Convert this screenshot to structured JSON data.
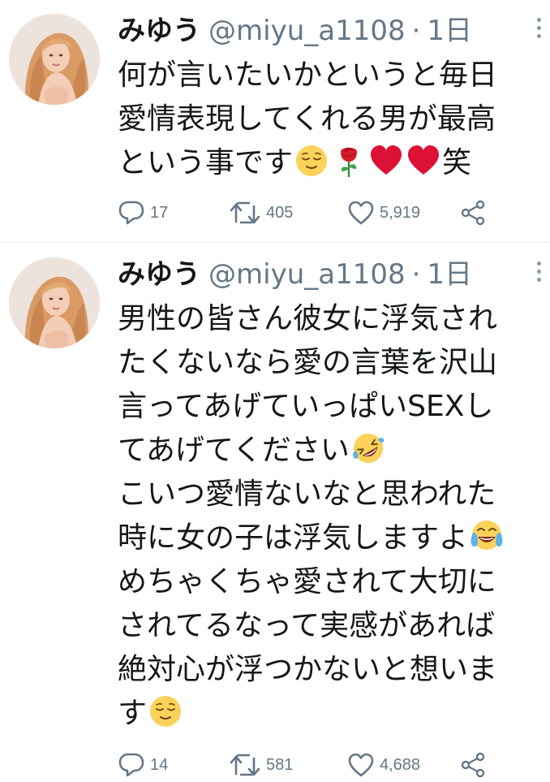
{
  "tweets": [
    {
      "author": {
        "name": "みゆう",
        "handle": "@miyu_a1108",
        "avatar_icon": "profile-photo"
      },
      "separator": "·",
      "time": "1日",
      "text_lines": [
        "何が言いたいかというと毎日",
        "愛情表現してくれる男が最高",
        "という事です",
        "笑"
      ],
      "emojis": [
        "relieved-face",
        "rose",
        "heart",
        "heart"
      ],
      "stats": {
        "replies": "17",
        "retweets": "405",
        "likes": "5,919"
      }
    },
    {
      "author": {
        "name": "みゆう",
        "handle": "@miyu_a1108",
        "avatar_icon": "profile-photo"
      },
      "separator": "·",
      "time": "1日",
      "text_lines": [
        "男性の皆さん彼女に浮気され",
        "たくないなら愛の言葉を沢山",
        "言ってあげていっぱいSEXし",
        "てあげてください",
        "こいつ愛情ないなと思われた",
        "時に女の子は浮気しますよ",
        "めちゃくちゃ愛されて大切に",
        "されてるなって実感があれば",
        "絶対心が浮つかないと想いま",
        "す"
      ],
      "emojis": [
        "rolling-on-floor-laughing",
        "face-with-tears-of-joy",
        "relieved-face"
      ],
      "stats": {
        "replies": "14",
        "retweets": "581",
        "likes": "4,688"
      }
    }
  ],
  "colors": {
    "text": "#14171a",
    "secondary": "#657786",
    "divider": "#e1e8ed",
    "heart": "#e0112b"
  },
  "icons": [
    "reply-icon",
    "retweet-icon",
    "like-icon",
    "share-icon",
    "more-icon"
  ]
}
